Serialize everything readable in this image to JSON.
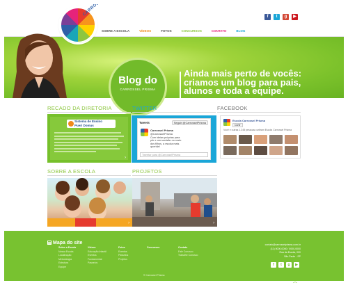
{
  "header": {
    "logo_text": "CARROSSEL PRISMA",
    "social_icons": [
      {
        "name": "facebook",
        "glyph": "f",
        "color": "#3b5998"
      },
      {
        "name": "twitter",
        "glyph": "t",
        "color": "#1aa6d8"
      },
      {
        "name": "google-plus",
        "glyph": "g",
        "color": "#d34836"
      },
      {
        "name": "youtube",
        "glyph": "▶",
        "color": "#cc181e"
      }
    ],
    "nav": [
      {
        "label": "SOBRE A ESCOLA",
        "color": "#555555"
      },
      {
        "label": "VÍDEOS",
        "color": "#f08a1c"
      },
      {
        "label": "FOTOS",
        "color": "#555555"
      },
      {
        "label": "CONCURSOS",
        "color": "#8cc63f"
      },
      {
        "label": "CONTATO",
        "color": "#e6237a"
      },
      {
        "label": "BLOG",
        "color": "#1aa6d8"
      }
    ]
  },
  "hero": {
    "badge_title": "Blog do",
    "badge_subtitle": "CARROSSEL PRISMA",
    "tagline_lines": [
      "Ainda mais perto de vocês:",
      "criamos um blog para pais,",
      "alunos e toda a equipe."
    ]
  },
  "sections": {
    "recado": "RECADO DA DIRETORIA",
    "twitter": "TWITTER",
    "facebook": "FACEBOOK",
    "sobre": "SOBRE A ESCOLA",
    "projetos": "PROJETOS"
  },
  "recado_card": {
    "logo_line1": "Sistema de Ensino",
    "logo_line2": "Pueri Domus"
  },
  "twitter_widget": {
    "header": "Tweets",
    "follow": "Seguir @CarrosselPrisma",
    "name": "Carrossel Prisma",
    "text_lines": [
      "@CarrosselPrisma",
      "Com ideias próprias para",
      "pôr e um sorrisão no rosto",
      "dos filhos, a escola mais",
      "querida!"
    ],
    "compose_placeholder": "Tweetar para @CarrosselPrisma"
  },
  "facebook_widget": {
    "name": "Escola Carrossel Prisma",
    "like": "Curtir",
    "count": "Você e outras 1.245 pessoas curtiram Escola Carrossel Prisma"
  },
  "footer": {
    "title": "Mapa do site",
    "columns": [
      {
        "items": [
          "Sobre a Escola",
          "Nossa Escola",
          "Localização",
          "Metodologia",
          "Estrutura",
          "Equipe"
        ]
      },
      {
        "items": [
          "Vídeos",
          "Educação Infantil",
          "Eventos",
          "Fundamental",
          "Passeios"
        ]
      },
      {
        "items": [
          "Fotos",
          "Eventos",
          "Passeios",
          "Projetos"
        ]
      },
      {
        "items": [
          "Concursos"
        ]
      },
      {
        "items": [
          "Contato",
          "Fale Conosco",
          "Trabalhe Conosco"
        ]
      }
    ],
    "contact_lines": [
      "contato@carrosselprisma.com.br",
      "(11) 0000-0000 / 0000-0000",
      "Rua da Escola, 000",
      "São Paulo - SP"
    ],
    "social_glyphs": [
      "f",
      "t",
      "g",
      "▶"
    ],
    "copyright": "© Carrossel Prisma"
  }
}
